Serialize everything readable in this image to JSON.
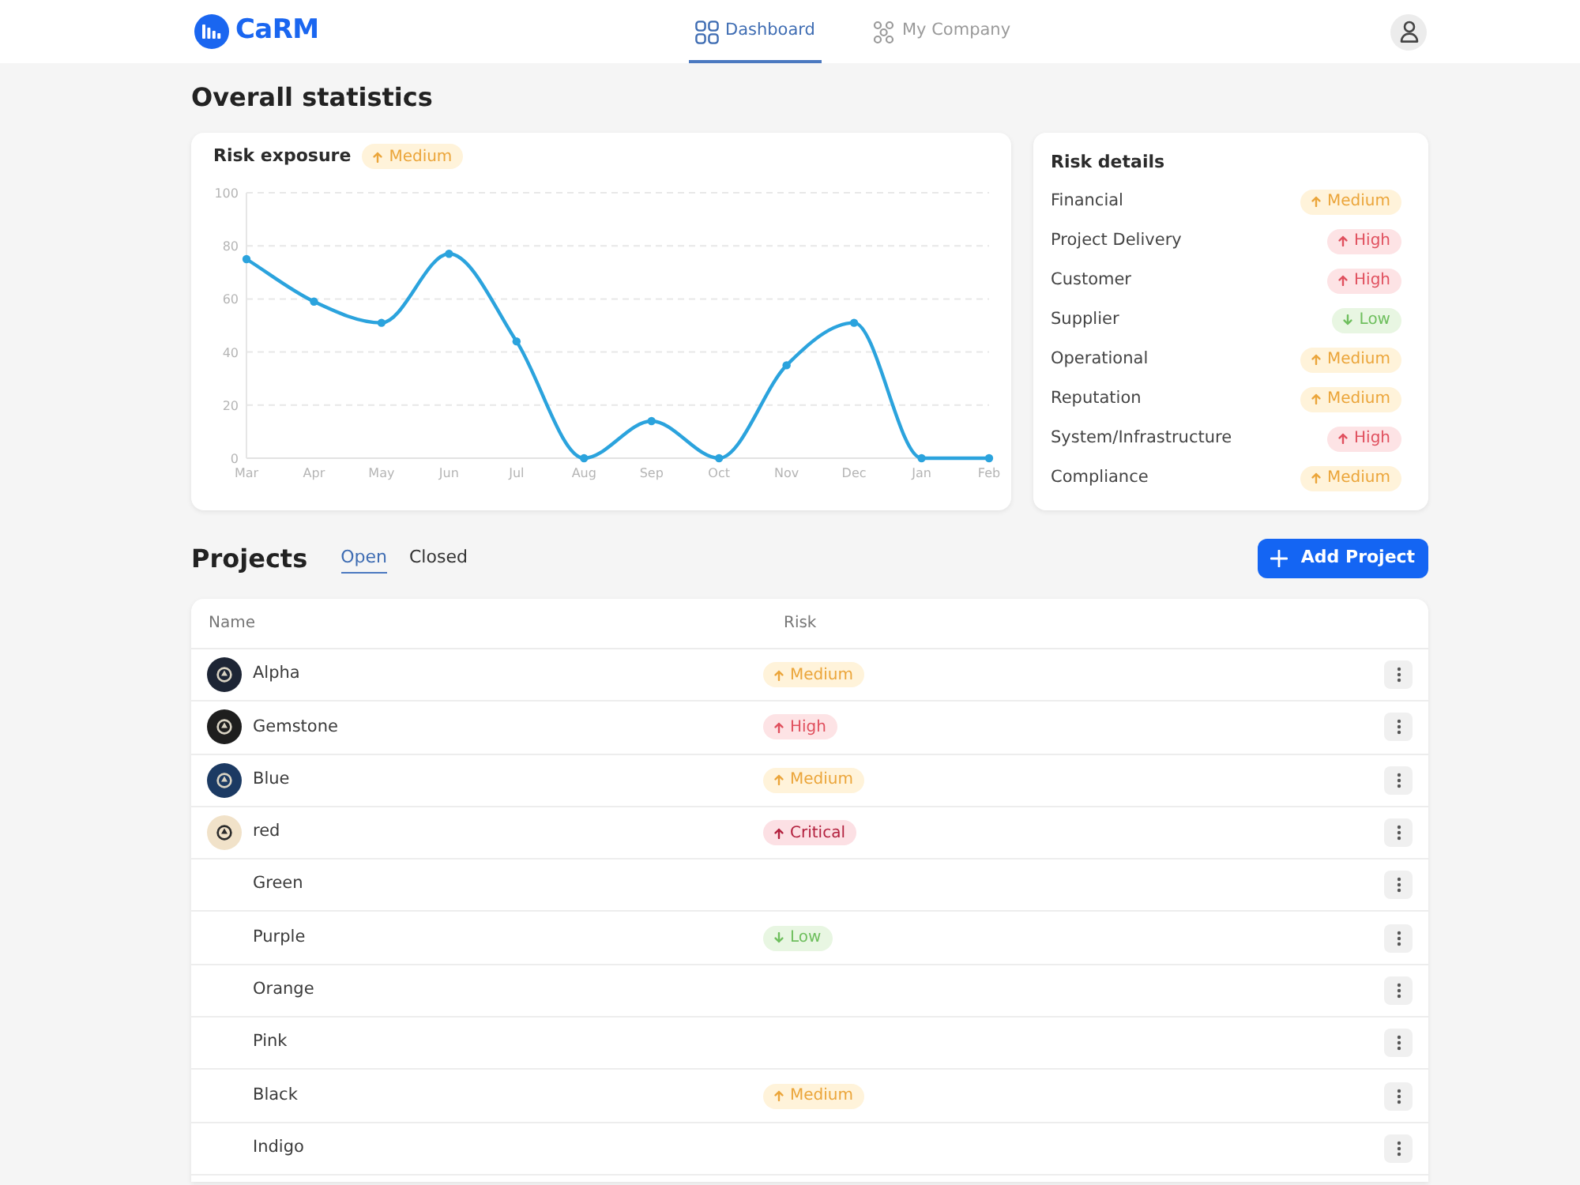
{
  "navbar": {
    "brand": "CaRM",
    "tabs": [
      {
        "label": "Dashboard",
        "selected": true
      },
      {
        "label": "My Company",
        "selected": false
      }
    ]
  },
  "overview": {
    "title": "Overall statistics",
    "risk_exposure": {
      "badge": {
        "label": "Medium",
        "kind": "medium"
      },
      "chart_data": {
        "type": "line",
        "title": "Risk exposure",
        "categories": [
          "Mar",
          "Apr",
          "May",
          "Jun",
          "Jul",
          "Aug",
          "Sep",
          "Oct",
          "Nov",
          "Dec",
          "Jan",
          "Feb"
        ],
        "series": [
          {
            "color": "#2ba3dd",
            "marker": "circle",
            "values": [
              75,
              59,
              51,
              77,
              44,
              0,
              14,
              0,
              35,
              51,
              0,
              0
            ]
          }
        ],
        "ylim": [
          0,
          100
        ],
        "yticks": [
          0,
          20,
          40,
          60,
          80,
          100
        ],
        "grid": true
      }
    },
    "risk_details": {
      "title": "Risk details",
      "items": [
        {
          "name": "Financial",
          "risk": {
            "label": "Medium",
            "kind": "medium"
          }
        },
        {
          "name": "Project Delivery",
          "risk": {
            "label": "High",
            "kind": "high"
          }
        },
        {
          "name": "Customer",
          "risk": {
            "label": "High",
            "kind": "high"
          }
        },
        {
          "name": "Supplier",
          "risk": {
            "label": "Low",
            "kind": "low"
          }
        },
        {
          "name": "Operational",
          "risk": {
            "label": "Medium",
            "kind": "medium"
          }
        },
        {
          "name": "Reputation",
          "risk": {
            "label": "Medium",
            "kind": "medium"
          }
        },
        {
          "name": "System/Infrastructure",
          "risk": {
            "label": "High",
            "kind": "high"
          }
        },
        {
          "name": "Compliance",
          "risk": {
            "label": "Medium",
            "kind": "medium"
          }
        }
      ]
    }
  },
  "projects": {
    "title": "Projects",
    "tabs": [
      {
        "label": "Open",
        "selected": true
      },
      {
        "label": "Closed",
        "selected": false
      }
    ],
    "add_button": "Add Project",
    "table": {
      "columns": [
        "Name",
        "Risk"
      ],
      "rows": [
        {
          "name": "Alpha",
          "color": "#1d2535",
          "risk": {
            "label": "Medium",
            "kind": "medium"
          }
        },
        {
          "name": "Gemstone",
          "color": "#1e1e1e",
          "risk": {
            "label": "High",
            "kind": "high"
          }
        },
        {
          "name": "Blue",
          "color": "#1c3a63",
          "risk": {
            "label": "Medium",
            "kind": "medium"
          }
        },
        {
          "name": "red",
          "color": "#f1e2c9",
          "risk": {
            "label": "Critical",
            "kind": "critical"
          }
        },
        {
          "name": "Green"
        },
        {
          "name": "Purple",
          "risk": {
            "label": "Low",
            "kind": "low"
          }
        },
        {
          "name": "Orange"
        },
        {
          "name": "Pink"
        },
        {
          "name": "Black",
          "risk": {
            "label": "Medium",
            "kind": "medium"
          }
        },
        {
          "name": "Indigo"
        }
      ]
    }
  }
}
